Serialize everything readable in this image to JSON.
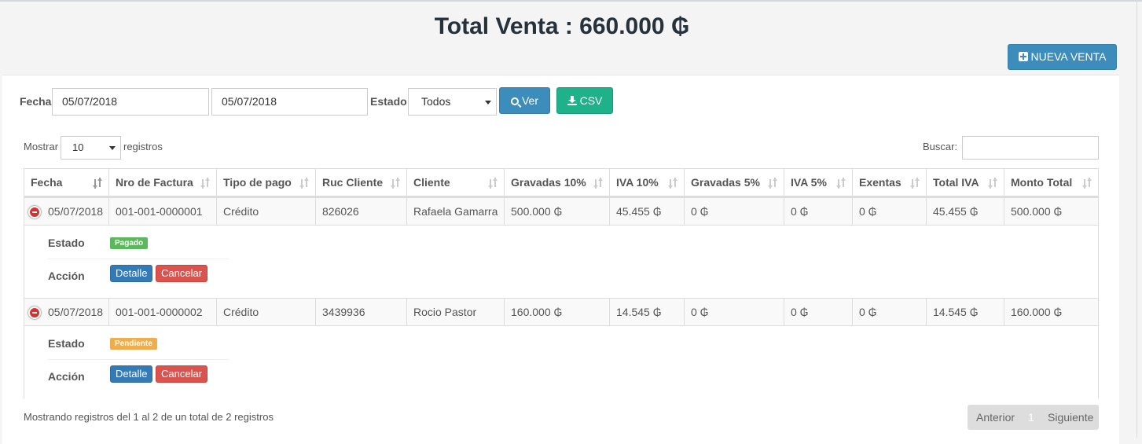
{
  "page": {
    "title": "Total Venta : 660.000 ₲",
    "new_sale_label": "NUEVA VENTA"
  },
  "filters": {
    "fecha_label": "Fecha",
    "date_from": "05/07/2018",
    "date_to": "05/07/2018",
    "estado_label": "Estado",
    "estado_value": "Todos",
    "ver_label": "Ver",
    "csv_label": "CSV"
  },
  "table_controls": {
    "show_label": "Mostrar",
    "show_value": "10",
    "records_label": "registros",
    "search_label": "Buscar:",
    "search_value": ""
  },
  "columns": [
    "Fecha",
    "Nro de Factura",
    "Tipo de pago",
    "Ruc Cliente",
    "Cliente",
    "Gravadas 10%",
    "IVA 10%",
    "Gravadas 5%",
    "IVA 5%",
    "Exentas",
    "Total IVA",
    "Monto Total"
  ],
  "rows": [
    {
      "cells": [
        "05/07/2018",
        "001-001-0000001",
        "Crédito",
        "826026",
        "Rafaela Gamarra",
        "500.000 ₲",
        "45.455 ₲",
        "0 ₲",
        "0 ₲",
        "0 ₲",
        "45.455 ₲",
        "500.000 ₲"
      ],
      "estado_label": "Estado",
      "estado_badge": "Pagado",
      "accion_label": "Acción",
      "detalle_label": "Detalle",
      "cancelar_label": "Cancelar"
    },
    {
      "cells": [
        "05/07/2018",
        "001-001-0000002",
        "Crédito",
        "3439936",
        "Rocio Pastor",
        "160.000 ₲",
        "14.545 ₲",
        "0 ₲",
        "0 ₲",
        "0 ₲",
        "14.545 ₲",
        "160.000 ₲"
      ],
      "estado_label": "Estado",
      "estado_badge": "Pendiente",
      "accion_label": "Acción",
      "detalle_label": "Detalle",
      "cancelar_label": "Cancelar"
    }
  ],
  "footer": {
    "info": "Mostrando registros del 1 al 2 de un total de 2 registros",
    "prev_label": "Anterior",
    "page_label": "1",
    "next_label": "Siguiente"
  },
  "colors": {
    "primary": "#3c8dbc",
    "csv": "#1fb18a",
    "badge_paid": "#5cb85c",
    "badge_pending": "#f0ad4e",
    "danger": "#d9534f"
  }
}
